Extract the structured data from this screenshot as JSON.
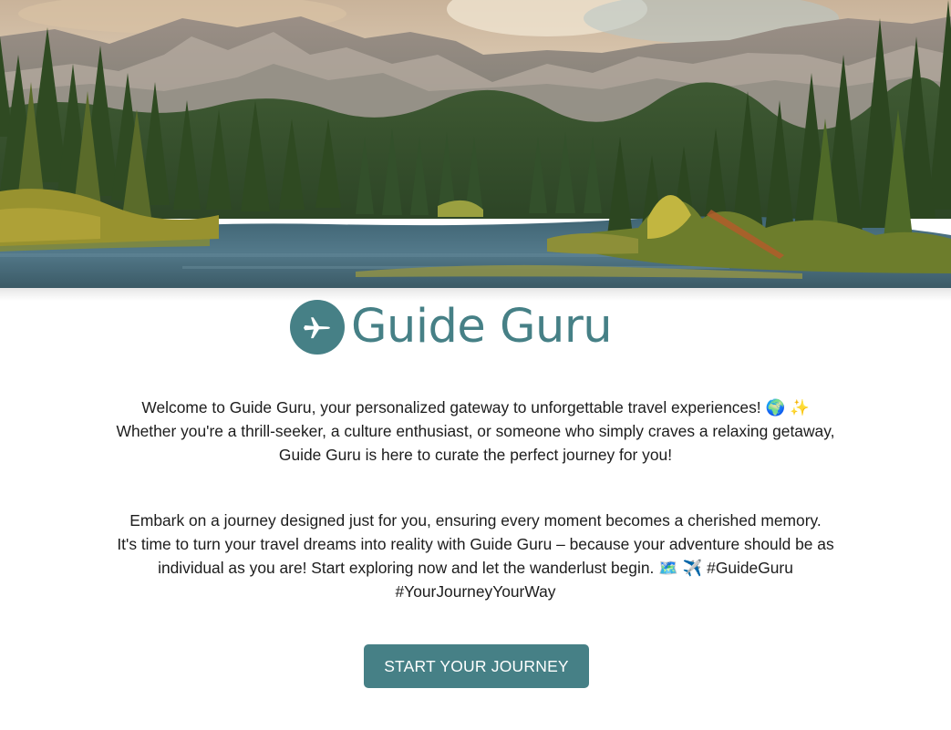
{
  "hero": {
    "image_alt": "Mountain lake surrounded by pine forest"
  },
  "brand": {
    "icon": "airplane-icon",
    "name": "Guide Guru",
    "color": "#468086"
  },
  "intro": {
    "line1": "Welcome to Guide Guru, your personalized gateway to unforgettable travel experiences! 🌍 ✨",
    "line2": "Whether you're a thrill-seeker, a culture enthusiast, or someone who simply craves a relaxing getaway,",
    "line3": "Guide Guru is here to curate the perfect journey for you!"
  },
  "outro": {
    "line1": "Embark on a journey designed just for you, ensuring every moment becomes a cherished memory.",
    "line2": "It's time to turn your travel dreams into reality with Guide Guru – because your adventure should be as",
    "line3": "individual as you are! Start exploring now and let the wanderlust begin. 🗺️ ✈️ #GuideGuru",
    "line4": "#YourJourneyYourWay"
  },
  "cta": {
    "label": "START YOUR JOURNEY"
  }
}
